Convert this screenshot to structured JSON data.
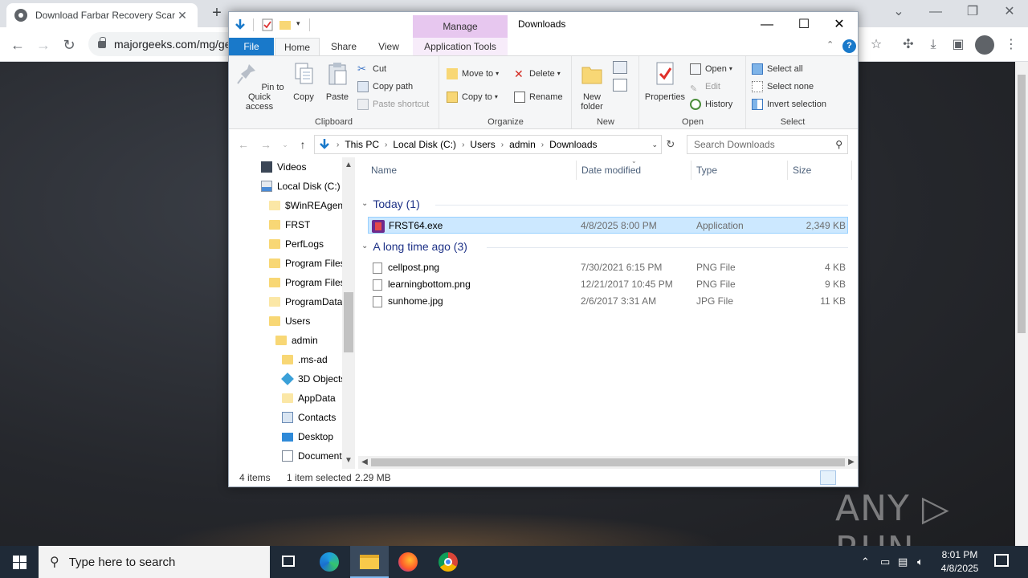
{
  "browser": {
    "tab_title": "Download Farbar Recovery Scan",
    "tab_close": "✕",
    "new_tab": "+",
    "url": "majorgeeks.com/mg/ge"
  },
  "explorer": {
    "title": "Downloads",
    "contextual_tab": "Manage",
    "tabs": {
      "file": "File",
      "home": "Home",
      "share": "Share",
      "view": "View",
      "app_tools": "Application Tools"
    },
    "ribbon": {
      "clipboard": {
        "label": "Clipboard",
        "pin": "Pin to Quick access",
        "copy": "Copy",
        "paste": "Paste",
        "cut": "Cut",
        "copy_path": "Copy path",
        "paste_shortcut": "Paste shortcut"
      },
      "organize": {
        "label": "Organize",
        "move_to": "Move to",
        "copy_to": "Copy to",
        "delete": "Delete",
        "rename": "Rename"
      },
      "new": {
        "label": "New",
        "new_folder": "New folder"
      },
      "open": {
        "label": "Open",
        "properties": "Properties",
        "open": "Open",
        "edit": "Edit",
        "history": "History"
      },
      "select": {
        "label": "Select",
        "select_all": "Select all",
        "select_none": "Select none",
        "invert": "Invert selection"
      }
    },
    "breadcrumb": [
      "This PC",
      "Local Disk (C:)",
      "Users",
      "admin",
      "Downloads"
    ],
    "search_placeholder": "Search Downloads",
    "nav_items": [
      {
        "label": "Videos"
      },
      {
        "label": "Local Disk (C:)"
      },
      {
        "label": "$WinREAgent"
      },
      {
        "label": "FRST"
      },
      {
        "label": "PerfLogs"
      },
      {
        "label": "Program Files"
      },
      {
        "label": "Program Files"
      },
      {
        "label": "ProgramData"
      },
      {
        "label": "Users"
      },
      {
        "label": "admin"
      },
      {
        "label": ".ms-ad"
      },
      {
        "label": "3D Objects"
      },
      {
        "label": "AppData"
      },
      {
        "label": "Contacts"
      },
      {
        "label": "Desktop"
      },
      {
        "label": "Documents"
      }
    ],
    "columns": {
      "name": "Name",
      "date": "Date modified",
      "type": "Type",
      "size": "Size"
    },
    "groups": [
      {
        "title": "Today (1)",
        "files": [
          {
            "name": "FRST64.exe",
            "date": "4/8/2025 8:00 PM",
            "type": "Application",
            "size": "2,349 KB",
            "selected": true
          }
        ]
      },
      {
        "title": "A long time ago (3)",
        "files": [
          {
            "name": "cellpost.png",
            "date": "7/30/2021 6:15 PM",
            "type": "PNG File",
            "size": "4 KB"
          },
          {
            "name": "learningbottom.png",
            "date": "12/21/2017 10:45 PM",
            "type": "PNG File",
            "size": "9 KB"
          },
          {
            "name": "sunhome.jpg",
            "date": "2/6/2017 3:31 AM",
            "type": "JPG File",
            "size": "11 KB"
          }
        ]
      }
    ],
    "status": {
      "items": "4 items",
      "selected": "1 item selected",
      "size": "2.29 MB"
    }
  },
  "watermark": "ANY ▷ RUN",
  "taskbar": {
    "search_placeholder": "Type here to search",
    "time": "8:01 PM",
    "date": "4/8/2025"
  },
  "colors": {
    "accent": "#1979ca",
    "selection": "#cce8ff",
    "manage_tab": "#e7c7ef",
    "taskbar": "#1f2a37"
  }
}
